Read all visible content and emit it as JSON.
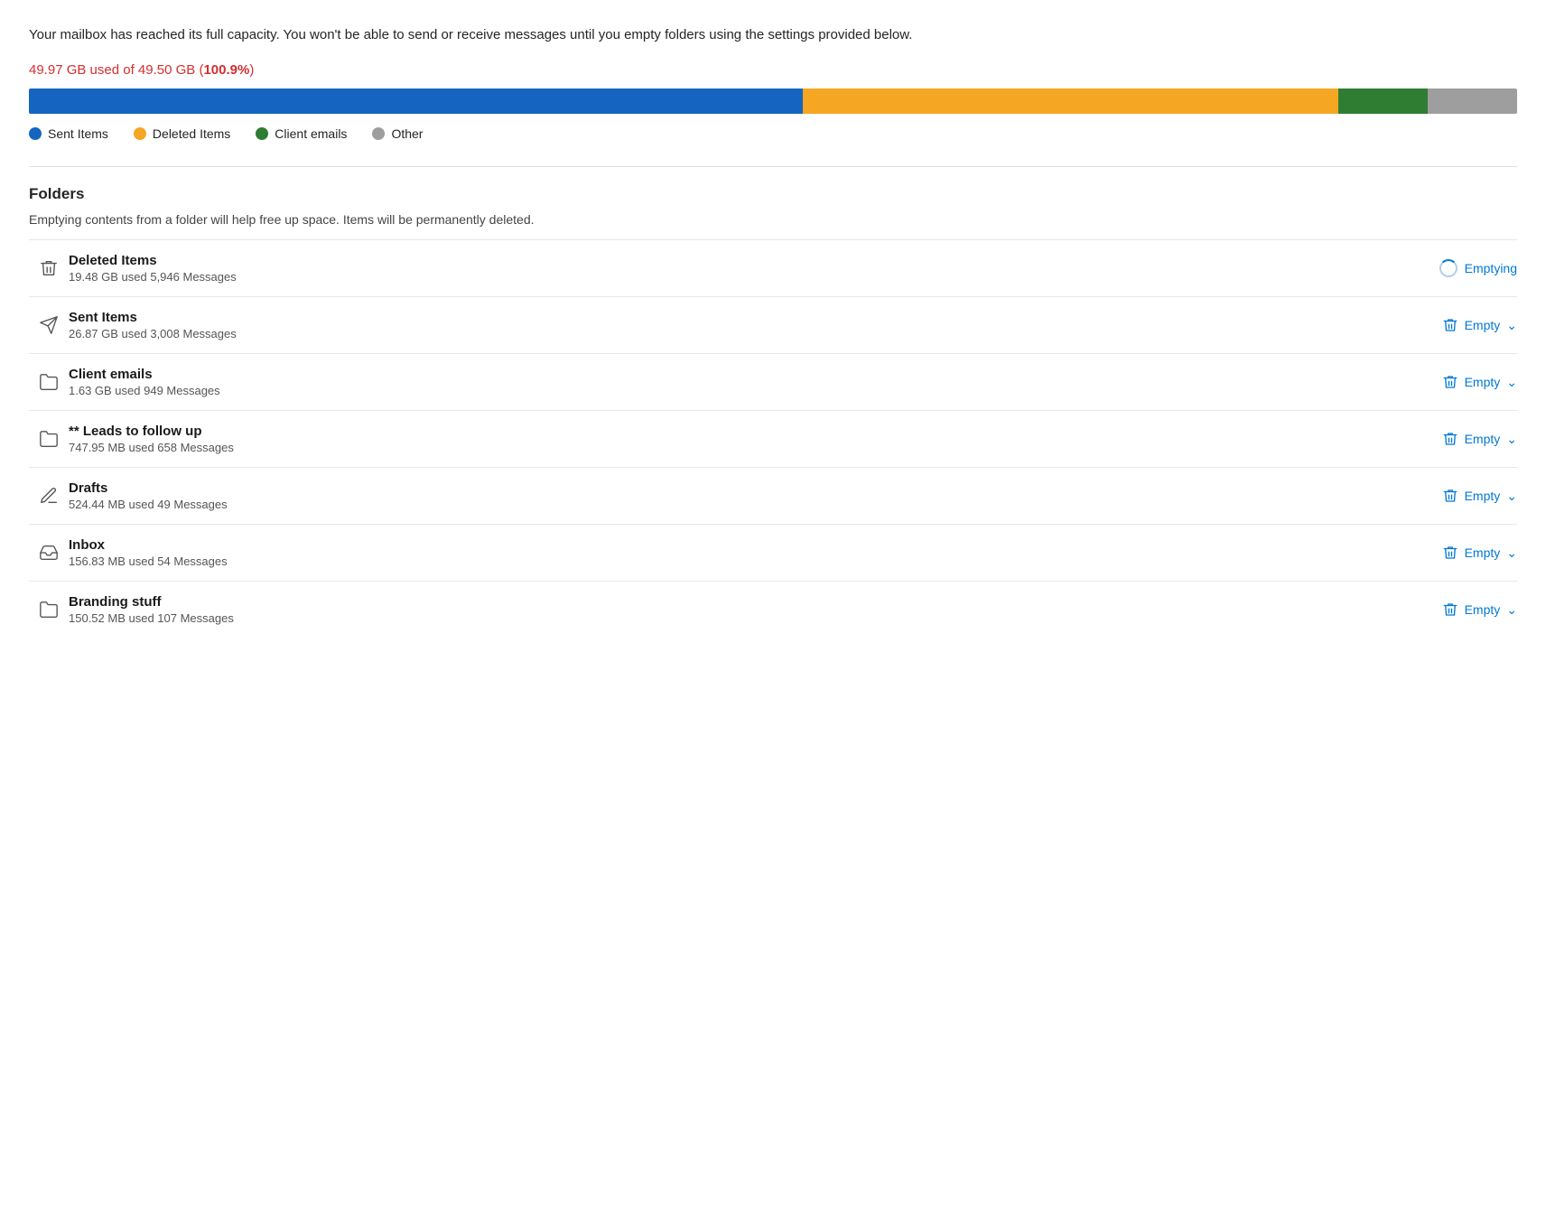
{
  "warning": {
    "text": "Your mailbox has reached its full capacity. You won't be able to send or receive messages until you empty folders using the settings provided below."
  },
  "usage": {
    "label": "49.97 GB used of 49.50 GB (",
    "percent": "100.9%",
    "suffix": ")"
  },
  "progressBar": {
    "segments": [
      {
        "label": "Sent Items",
        "color": "#1565c0",
        "width": "52"
      },
      {
        "label": "Deleted Items",
        "color": "#f5a623",
        "width": "36"
      },
      {
        "label": "Client emails",
        "color": "#2e7d32",
        "width": "6"
      },
      {
        "label": "Other",
        "color": "#9e9e9e",
        "width": "6"
      }
    ]
  },
  "legend": [
    {
      "label": "Sent Items",
      "color": "#1565c0"
    },
    {
      "label": "Deleted Items",
      "color": "#f5a623"
    },
    {
      "label": "Client emails",
      "color": "#2e7d32"
    },
    {
      "label": "Other",
      "color": "#9e9e9e"
    }
  ],
  "folders": {
    "title": "Folders",
    "subtitle": "Emptying contents from a folder will help free up space. Items will be permanently deleted.",
    "items": [
      {
        "id": "deleted-items",
        "name": "Deleted Items",
        "meta": "19.48 GB used  5,946 Messages",
        "icon": "trash",
        "action": "emptying"
      },
      {
        "id": "sent-items",
        "name": "Sent Items",
        "meta": "26.87 GB used  3,008 Messages",
        "icon": "send",
        "action": "empty"
      },
      {
        "id": "client-emails",
        "name": "Client emails",
        "meta": "1.63 GB used  949 Messages",
        "icon": "folder",
        "action": "empty"
      },
      {
        "id": "leads-follow-up",
        "name": "** Leads to follow up",
        "meta": "747.95 MB used  658 Messages",
        "icon": "folder",
        "action": "empty"
      },
      {
        "id": "drafts",
        "name": "Drafts",
        "meta": "524.44 MB used  49 Messages",
        "icon": "pencil",
        "action": "empty"
      },
      {
        "id": "inbox",
        "name": "Inbox",
        "meta": "156.83 MB used  54 Messages",
        "icon": "inbox",
        "action": "empty"
      },
      {
        "id": "branding-stuff",
        "name": "Branding stuff",
        "meta": "150.52 MB used  107 Messages",
        "icon": "folder",
        "action": "empty"
      }
    ],
    "empty_label": "Empty",
    "emptying_label": "Emptying"
  },
  "colors": {
    "accent": "#0078d4",
    "red": "#d32f2f"
  }
}
